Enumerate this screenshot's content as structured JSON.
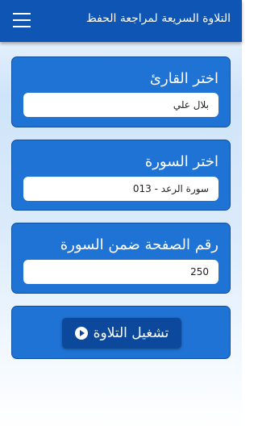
{
  "app_bar": {
    "title": "التلاوة السريعة لمراجعة الحفظ",
    "menu_icon": "hamburger-menu-icon"
  },
  "reciter": {
    "label": "اختر القارئ",
    "value": "بلال علي"
  },
  "surah": {
    "label": "اختر السورة",
    "value": "013 - سورة الرعد"
  },
  "page": {
    "label": "رقم الصفحة ضمن السورة",
    "value": "250"
  },
  "play": {
    "label": "تشغيل التلاوة",
    "icon": "play-circle-icon"
  },
  "colors": {
    "app_bar": "#0f55b3",
    "card": "#1f73d4",
    "button": "#0c489c"
  }
}
